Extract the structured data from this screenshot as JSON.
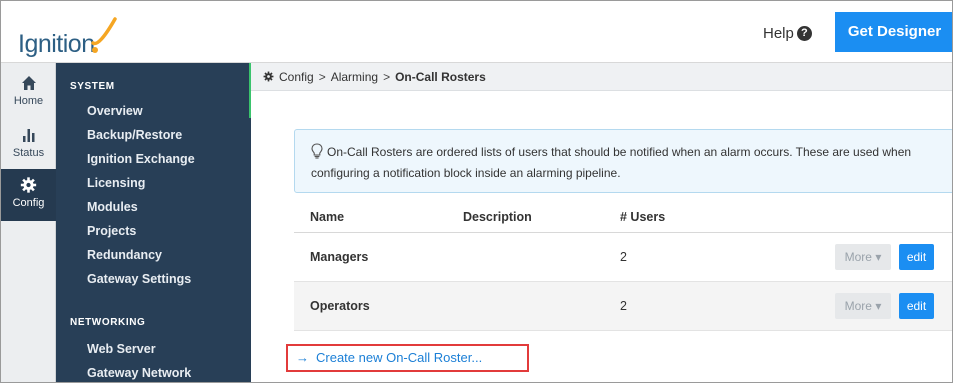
{
  "header": {
    "logo_text": "Ignition",
    "help_label": "Help",
    "help_icon": "?",
    "get_designer_label": "Get Designer",
    "brand_color": "#1b8ef2"
  },
  "rail": {
    "items": [
      {
        "label": "Home",
        "icon": "home-icon"
      },
      {
        "label": "Status",
        "icon": "status-bars-icon"
      },
      {
        "label": "Config",
        "icon": "gear-icon",
        "active": true
      }
    ]
  },
  "sidebar": {
    "sections": [
      {
        "heading": "SYSTEM",
        "items": [
          "Overview",
          "Backup/Restore",
          "Ignition Exchange",
          "Licensing",
          "Modules",
          "Projects",
          "Redundancy",
          "Gateway Settings"
        ]
      },
      {
        "heading": "NETWORKING",
        "items": [
          "Web Server",
          "Gateway Network"
        ]
      }
    ]
  },
  "breadcrumb": {
    "icon": "gear-icon",
    "items": [
      "Config",
      "Alarming",
      "On-Call Rosters"
    ],
    "separator": ">"
  },
  "info": {
    "text_line1": "On-Call Rosters are ordered lists of users that should be notified when an alarm occurs. These are used when",
    "text_line2": "configuring a notification block inside an alarming pipeline."
  },
  "table": {
    "columns": [
      "Name",
      "Description",
      "# Users"
    ],
    "rows": [
      {
        "name": "Managers",
        "description": "",
        "users": "2",
        "more_label": "More",
        "edit_label": "edit"
      },
      {
        "name": "Operators",
        "description": "",
        "users": "2",
        "more_label": "More",
        "edit_label": "edit"
      }
    ]
  },
  "actions": {
    "create_arrow": "→",
    "create_label": "Create new On-Call Roster..."
  }
}
